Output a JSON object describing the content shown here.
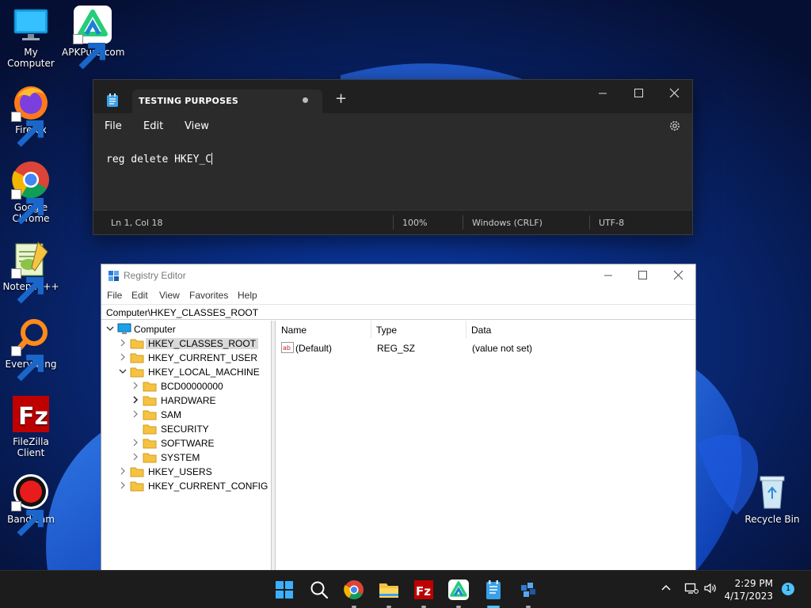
{
  "desktop": {
    "icons": [
      {
        "label": "My Computer"
      },
      {
        "label": "APKPure.com"
      },
      {
        "label": "Firefox"
      },
      {
        "label": "Google Chrome"
      },
      {
        "label": "Notepad++"
      },
      {
        "label": "Everything"
      },
      {
        "label": "FileZilla Client"
      },
      {
        "label": "Bandicam"
      },
      {
        "label": "Recycle Bin"
      }
    ]
  },
  "notepad": {
    "tab_title": "TESTING PURPOSES",
    "new_tab": "+",
    "menu": [
      "File",
      "Edit",
      "View"
    ],
    "content": "reg delete HKEY_C",
    "status": {
      "position": "Ln 1, Col 18",
      "zoom": "100%",
      "line_ending": "Windows (CRLF)",
      "encoding": "UTF-8"
    },
    "icons": {
      "settings": "gear-icon"
    }
  },
  "regedit": {
    "title": "Registry Editor",
    "menu": [
      "File",
      "Edit",
      "View",
      "Favorites",
      "Help"
    ],
    "address": "Computer\\HKEY_CLASSES_ROOT",
    "tree": {
      "root": "Computer",
      "hives": [
        "HKEY_CLASSES_ROOT",
        "HKEY_CURRENT_USER",
        "HKEY_LOCAL_MACHINE",
        "HKEY_USERS",
        "HKEY_CURRENT_CONFIG"
      ],
      "hklm_children": [
        "BCD00000000",
        "HARDWARE",
        "SAM",
        "SECURITY",
        "SOFTWARE",
        "SYSTEM"
      ],
      "selected": "HKEY_CLASSES_ROOT"
    },
    "columns": [
      "Name",
      "Type",
      "Data"
    ],
    "values": [
      {
        "name": "(Default)",
        "type": "REG_SZ",
        "data": "(value not set)"
      }
    ]
  },
  "taskbar": {
    "time": "2:29 PM",
    "date": "4/17/2023",
    "notification_count": "1",
    "accent": "#4cc2ff"
  }
}
